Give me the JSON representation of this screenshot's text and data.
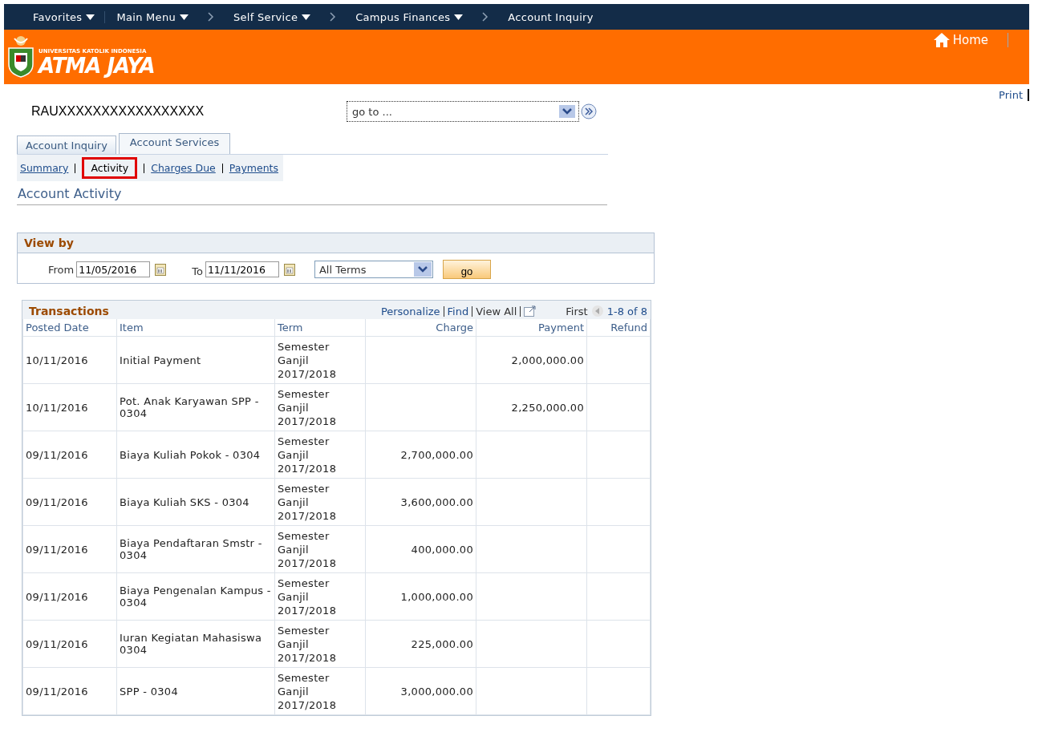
{
  "top_nav": [
    {
      "label": "Favorites",
      "dropdown": true,
      "separator": false
    },
    {
      "label": "Main Menu",
      "dropdown": true,
      "separator": false
    },
    {
      "label": "Self Service",
      "dropdown": true,
      "separator": true
    },
    {
      "label": "Campus Finances",
      "dropdown": true,
      "separator": true
    },
    {
      "label": "Account Inquiry",
      "dropdown": false,
      "separator": true
    }
  ],
  "banner": {
    "logo_small": "UNIVERSITAS KATOLIK INDONESIA",
    "logo_main": "ATMA JAYA",
    "home": "Home"
  },
  "print": "Print",
  "student_name": "RAUXXXXXXXXXXXXXXXXX",
  "goto": {
    "value": "go to ..."
  },
  "tabs": [
    {
      "label": "Account Inquiry",
      "selected": false
    },
    {
      "label": "Account Services",
      "selected": true
    }
  ],
  "subnav": [
    {
      "label": "Summary",
      "selected": false
    },
    {
      "label": "Activity",
      "selected": true
    },
    {
      "label": "Charges Due",
      "selected": false
    },
    {
      "label": "Payments",
      "selected": false
    }
  ],
  "page_title": "Account Activity",
  "view_by": {
    "title": "View by",
    "from_label": "From",
    "from": "11/05/2016",
    "to_label": "To",
    "to": "11/11/2016",
    "term": "All Terms",
    "go": "go"
  },
  "transactions": {
    "title": "Transactions",
    "links": [
      "Personalize",
      "Find"
    ],
    "view_all": "View All",
    "first": "First",
    "range": "1-8 of 8",
    "columns": [
      "Posted Date",
      "Item",
      "Term",
      "Charge",
      "Payment",
      "Refund"
    ],
    "rows": [
      {
        "date": "10/11/2016",
        "item": "Initial Payment",
        "term": "Semester Ganjil 2017/2018",
        "charge": "",
        "payment": "2,000,000.00",
        "refund": ""
      },
      {
        "date": "10/11/2016",
        "item": "Pot. Anak Karyawan SPP - 0304",
        "term": "Semester Ganjil 2017/2018",
        "charge": "",
        "payment": "2,250,000.00",
        "refund": ""
      },
      {
        "date": "09/11/2016",
        "item": "Biaya Kuliah Pokok - 0304",
        "term": "Semester Ganjil 2017/2018",
        "charge": "2,700,000.00",
        "payment": "",
        "refund": ""
      },
      {
        "date": "09/11/2016",
        "item": "Biaya Kuliah SKS - 0304",
        "term": "Semester Ganjil 2017/2018",
        "charge": "3,600,000.00",
        "payment": "",
        "refund": ""
      },
      {
        "date": "09/11/2016",
        "item": "Biaya Pendaftaran Smstr - 0304",
        "term": "Semester Ganjil 2017/2018",
        "charge": "400,000.00",
        "payment": "",
        "refund": ""
      },
      {
        "date": "09/11/2016",
        "item": "Biaya Pengenalan Kampus - 0304",
        "term": "Semester Ganjil 2017/2018",
        "charge": "1,000,000.00",
        "payment": "",
        "refund": ""
      },
      {
        "date": "09/11/2016",
        "item": "Iuran Kegiatan Mahasiswa 0304",
        "term": "Semester Ganjil 2017/2018",
        "charge": "225,000.00",
        "payment": "",
        "refund": ""
      },
      {
        "date": "09/11/2016",
        "item": "SPP - 0304",
        "term": "Semester Ganjil 2017/2018",
        "charge": "3,000,000.00",
        "payment": "",
        "refund": ""
      }
    ]
  }
}
